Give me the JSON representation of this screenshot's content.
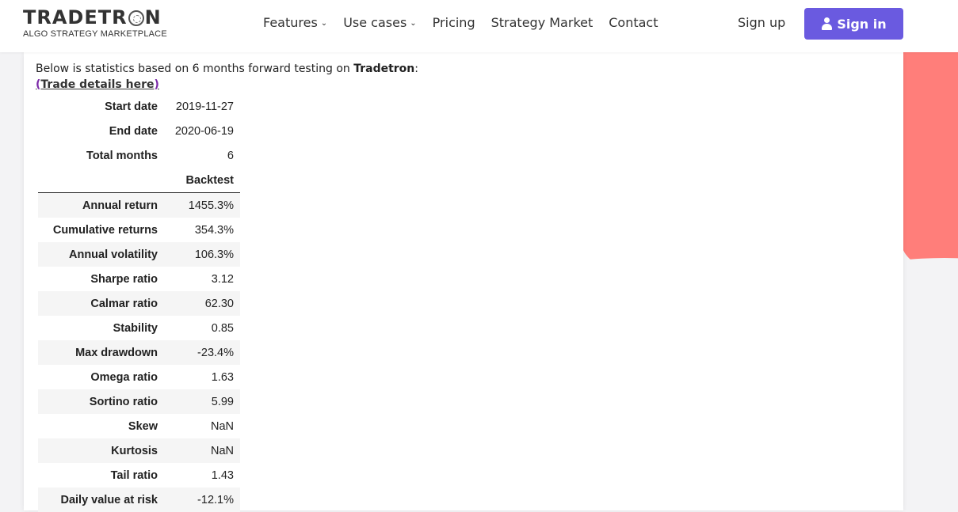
{
  "header": {
    "logo_title_a": "TRADETR",
    "logo_title_b": "N",
    "logo_subtitle": "ALGO STRATEGY MARKETPLACE",
    "nav": [
      "Features",
      "Use cases",
      "Pricing",
      "Strategy Market",
      "Contact"
    ],
    "sign_up": "Sign up",
    "sign_in": "Sign in",
    "accent_color": "#6a5ae0"
  },
  "intro": {
    "text": "Below is statistics based on 6 months forward testing on ",
    "brand": "Tradetron",
    "colon": ":",
    "link_open": "(",
    "link_text": "Trade details here",
    "link_close": ")"
  },
  "stats": {
    "start_date_label": "Start date",
    "start_date": "2019-11-27",
    "end_date_label": "End date",
    "end_date": "2020-06-19",
    "total_months_label": "Total months",
    "total_months": "6",
    "column_header": "Backtest",
    "rows": [
      {
        "label": "Annual return",
        "value": "1455.3%"
      },
      {
        "label": "Cumulative returns",
        "value": "354.3%"
      },
      {
        "label": "Annual volatility",
        "value": "106.3%"
      },
      {
        "label": "Sharpe ratio",
        "value": "3.12"
      },
      {
        "label": "Calmar ratio",
        "value": "62.30"
      },
      {
        "label": "Stability",
        "value": "0.85"
      },
      {
        "label": "Max drawdown",
        "value": "-23.4%"
      },
      {
        "label": "Omega ratio",
        "value": "1.63"
      },
      {
        "label": "Sortino ratio",
        "value": "5.99"
      },
      {
        "label": "Skew",
        "value": "NaN"
      },
      {
        "label": "Kurtosis",
        "value": "NaN"
      },
      {
        "label": "Tail ratio",
        "value": "1.43"
      },
      {
        "label": "Daily value at risk",
        "value": "-12.1%"
      }
    ]
  }
}
